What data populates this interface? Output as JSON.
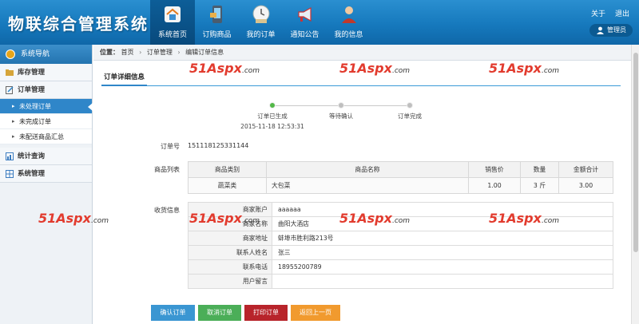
{
  "app": {
    "title": "物联综合管理系统"
  },
  "nav": [
    {
      "label": "系统首页",
      "icon": "home-icon",
      "active": true
    },
    {
      "label": "订购商品",
      "icon": "phone-order-icon",
      "active": false
    },
    {
      "label": "我的订单",
      "icon": "order-clock-icon",
      "active": false
    },
    {
      "label": "通知公告",
      "icon": "megaphone-icon",
      "active": false
    },
    {
      "label": "我的信息",
      "icon": "user-info-icon",
      "active": false
    }
  ],
  "top_links": {
    "about": "关于",
    "logout": "退出",
    "user": "管理员"
  },
  "sidebar": {
    "title": "系统导航",
    "groups": [
      {
        "label": "库存管理"
      },
      {
        "label": "订单管理",
        "items": [
          "未处理订单",
          "未完成订单",
          "未配送商品汇总"
        ]
      },
      {
        "label": "统计查询"
      },
      {
        "label": "系统管理"
      }
    ]
  },
  "breadcrumb": {
    "lead": "位置：",
    "items": [
      "首页",
      "订单管理",
      "编辑订单信息"
    ]
  },
  "tab": {
    "label": "订单详细信息"
  },
  "progress": {
    "steps": [
      "订单已生成",
      "等待确认",
      "订单完成"
    ],
    "completed_steps": 1,
    "timestamp": "2015-11-18 12:53:31"
  },
  "order": {
    "no_label": "订单号",
    "no_value": "151118125331144"
  },
  "goods": {
    "label": "商品列表",
    "headers": [
      "商品类别",
      "商品名称",
      "销售价",
      "数量",
      "金额合计"
    ],
    "rows": [
      [
        "蔬菜类",
        "大包菜",
        "1.00",
        "3 斤",
        "3.00"
      ]
    ]
  },
  "shipping": {
    "label": "收货信息",
    "rows": [
      {
        "k": "商家账户",
        "v": "aaaaaa"
      },
      {
        "k": "商家名称",
        "v": "曲阳大酒店"
      },
      {
        "k": "商家地址",
        "v": "蚌埠市胜利路213号"
      },
      {
        "k": "联系人姓名",
        "v": "张三"
      },
      {
        "k": "联系电话",
        "v": "18955200789"
      },
      {
        "k": "用户留言",
        "v": ""
      }
    ]
  },
  "buttons": {
    "confirm": "确认订单",
    "cancel": "取消订单",
    "print": "打印订单",
    "back": "返回上一页"
  },
  "watermark": {
    "brand": "51Aspx",
    "tld": ".com"
  },
  "colors": {
    "header": "#1679bd",
    "accent": "#2f86c9",
    "step_done": "#52b848",
    "watermark": "#e23b2e"
  }
}
